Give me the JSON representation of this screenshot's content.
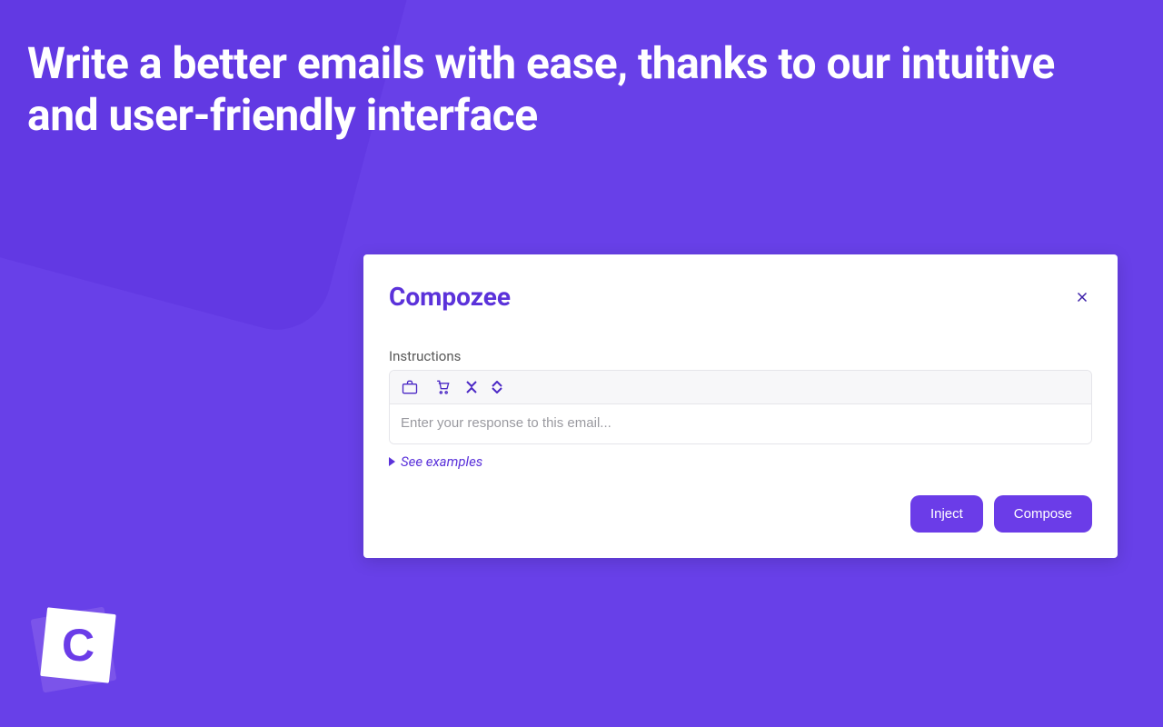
{
  "hero": {
    "headline": "Write a better emails with ease, thanks to our intuitive and user-friendly interface"
  },
  "card": {
    "title": "Compozee",
    "section_label": "Instructions",
    "input_placeholder": "Enter your response to this email...",
    "examples_label": "See examples",
    "inject_label": "Inject",
    "compose_label": "Compose"
  },
  "logo": {
    "letter": "C"
  },
  "colors": {
    "accent": "#6b3ce8"
  }
}
